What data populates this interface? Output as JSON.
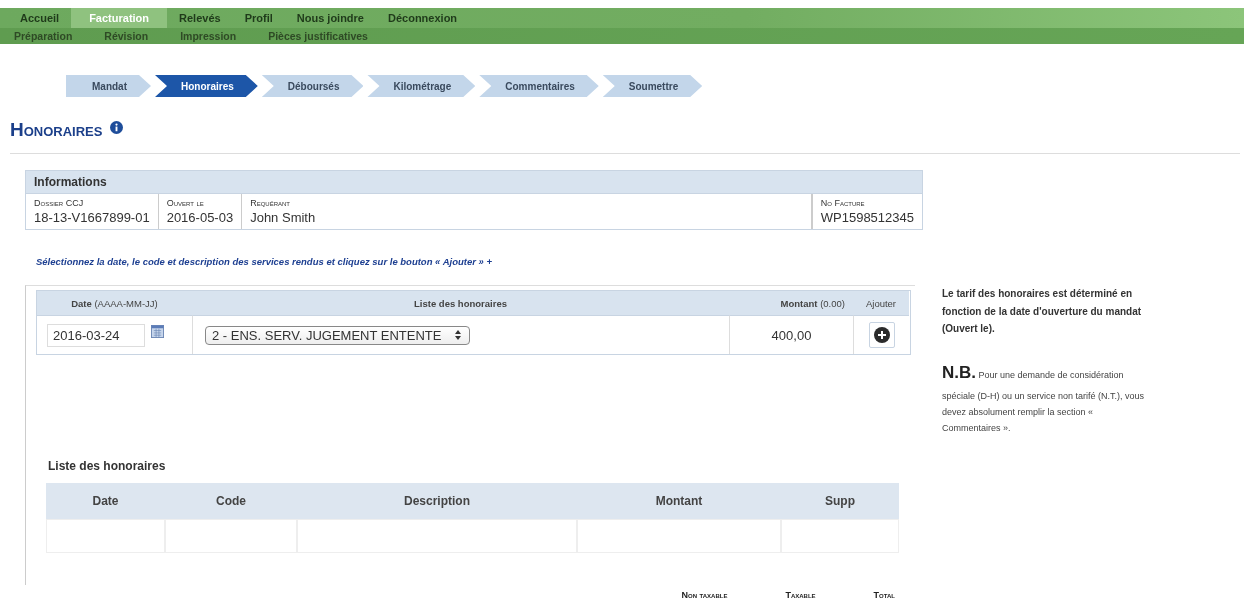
{
  "main_nav": [
    {
      "label": "Accueil",
      "selected": false
    },
    {
      "label": "Facturation",
      "selected": true
    },
    {
      "label": "Relevés",
      "selected": false
    },
    {
      "label": "Profil",
      "selected": false
    },
    {
      "label": "Nous joindre",
      "selected": false
    },
    {
      "label": "Déconnexion",
      "selected": false
    }
  ],
  "sub_nav": [
    {
      "label": "Préparation"
    },
    {
      "label": "Révision"
    },
    {
      "label": "Impression"
    },
    {
      "label": "Pièces justificatives"
    }
  ],
  "steps": [
    {
      "label": "Mandat",
      "selected": false
    },
    {
      "label": "Honoraires",
      "selected": true
    },
    {
      "label": "Déboursés",
      "selected": false
    },
    {
      "label": "Kilométrage",
      "selected": false
    },
    {
      "label": "Commentaires",
      "selected": false
    },
    {
      "label": "Soumettre",
      "selected": false
    }
  ],
  "page_title": "Honoraires",
  "informations": {
    "title": "Informations",
    "fields": [
      {
        "label": "Dossier CCJ",
        "value": "18-13-V1667899-01"
      },
      {
        "label": "Ouvert le",
        "value": "2016-05-03"
      },
      {
        "label": "Requérant",
        "value": "John Smith"
      },
      {
        "label": "No Facture",
        "value": "WP1598512345"
      }
    ]
  },
  "instruction": "Sélectionnez la date, le code et description des services rendus et cliquez sur le bouton « Ajouter » +",
  "entry_form": {
    "date_label": "Date",
    "date_hint": "(AAAA-MM-JJ)",
    "list_label": "Liste des honoraires",
    "amount_label": "Montant",
    "amount_hint": "(0.00)",
    "add_label": "Ajouter",
    "date_value": "2016-03-24",
    "fee_value": "2 - ENS. SERV. JUGEMENT ENTENTE",
    "amount_value": "400,00"
  },
  "sidebar": {
    "note": "Le tarif des honoraires est déterminé en fonction de la date d'ouverture du mandat (Ouvert le).",
    "nb_label": "N.B.",
    "nb_text": "Pour une demande de considération spéciale (D-H) ou un service non tarifé (N.T.), vous devez absolument remplir la section « Commentaires »."
  },
  "fee_list": {
    "title": "Liste des honoraires",
    "columns": [
      "Date",
      "Code",
      "Description",
      "Montant",
      "Supp"
    ]
  },
  "totals": {
    "columns": [
      "Non taxable",
      "Taxable",
      "Total"
    ]
  }
}
